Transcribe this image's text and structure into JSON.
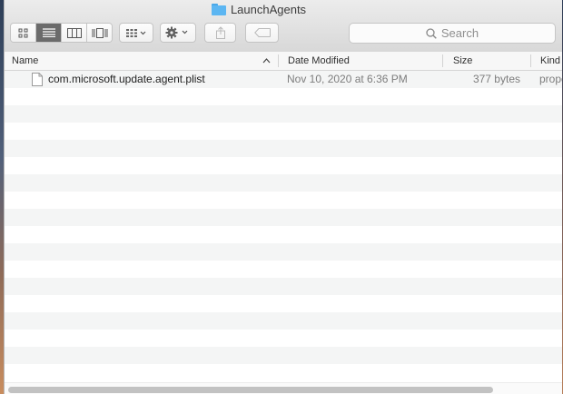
{
  "window": {
    "title": "LaunchAgents"
  },
  "toolbar": {
    "view_modes": [
      "icon-view",
      "list-view",
      "column-view",
      "cover-flow-view"
    ],
    "active_view": "list-view",
    "search_placeholder": "Search"
  },
  "columns": {
    "name": "Name",
    "date_modified": "Date Modified",
    "size": "Size",
    "kind": "Kind",
    "sorted_by": "Name",
    "sort_direction": "ascending"
  },
  "files": [
    {
      "name": "com.microsoft.update.agent.plist",
      "date_modified": "Nov 10, 2020 at 6:36 PM",
      "size": "377 bytes",
      "kind": "property list"
    }
  ],
  "colors": {
    "folder": "#5cb6f2",
    "active_segment": "#6b6b6b",
    "row_stripe": "#f4f5f5"
  }
}
